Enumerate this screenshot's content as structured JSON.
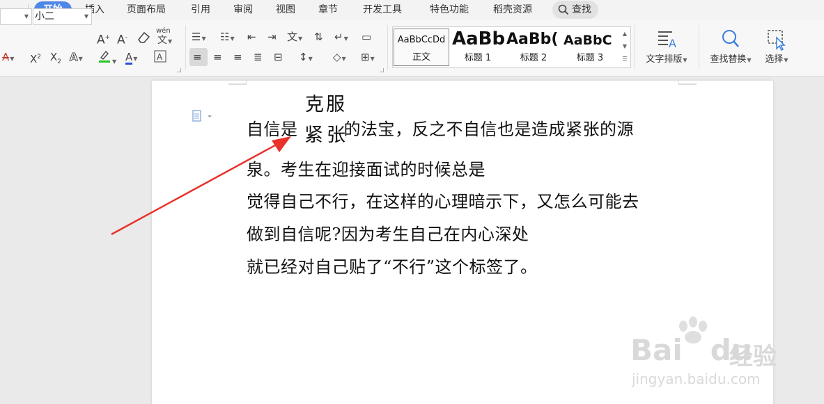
{
  "menu": {
    "tabs": [
      "开始",
      "插入",
      "页面布局",
      "引用",
      "审阅",
      "视图",
      "章节",
      "开发工具",
      "特色功能",
      "稻壳资源"
    ],
    "active_tab": "开始",
    "search_label": "查找"
  },
  "ribbon": {
    "font_name": "",
    "font_size": "小二",
    "styles": [
      {
        "preview": "AaBbCcDd",
        "name": "正文"
      },
      {
        "preview": "AaBb",
        "name": "标题 1"
      },
      {
        "preview": "AaBb(",
        "name": "标题 2"
      },
      {
        "preview": "AaBbC",
        "name": "标题 3"
      }
    ],
    "text_layout_label": "文字排版",
    "find_replace_label": "查找替换",
    "select_label": "选择",
    "pinyin_glyph": "wén"
  },
  "document": {
    "annotation_top": "克服",
    "annotation_replacement": "紧张",
    "lines": [
      {
        "before": "自信是",
        "after": "的法宝，反之不自信也是造成紧张的源"
      },
      {
        "text": "泉。考生在迎接面试的时候总是"
      },
      {
        "text": "觉得自己不行，在这样的心理暗示下，又怎么可能去"
      },
      {
        "text": "做到自信呢?因为考生自己在内心深处"
      },
      {
        "text": "就已经对自己贴了“不行”这个标签了。"
      }
    ]
  },
  "watermark": {
    "brand_left": "Bai",
    "brand_right": "du",
    "brand_cn": "经验",
    "url": "jingyan.baidu.com"
  },
  "colors": {
    "active_tab": "#4e87e8",
    "arrow": "#e8322a",
    "highlight": "#27c427",
    "font_color": "#2b4fd8"
  }
}
